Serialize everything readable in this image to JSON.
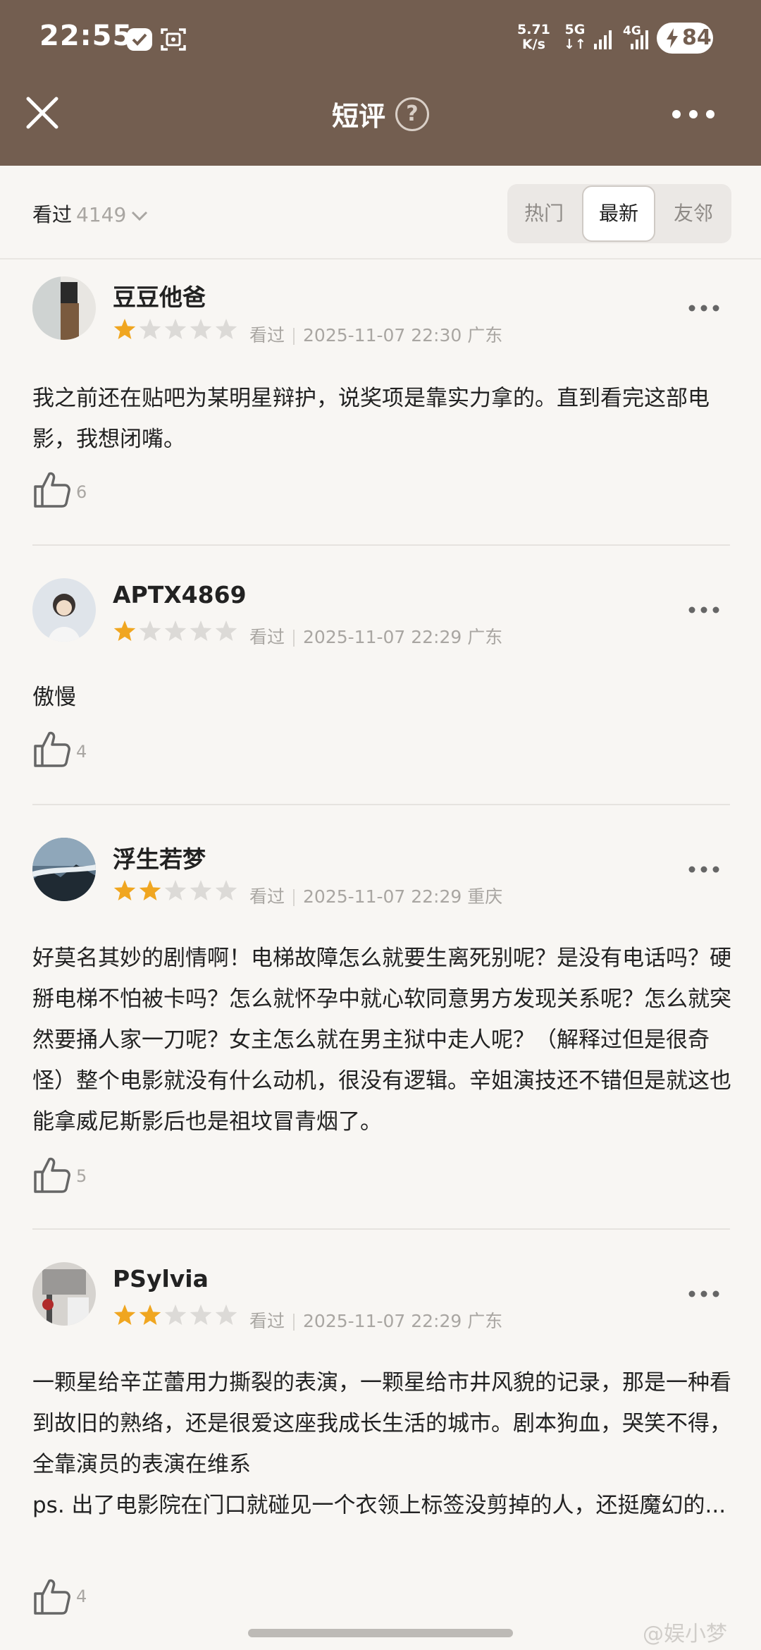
{
  "status": {
    "time": "22:55",
    "net_speed": "5.71",
    "net_unit": "K/s",
    "g5": "5G",
    "g4": "4G",
    "battery": "84"
  },
  "header": {
    "title": "短评",
    "help": "?"
  },
  "filter": {
    "watched_label": "看过",
    "watched_count": "4149",
    "tabs": [
      "热门",
      "最新",
      "友邻"
    ],
    "active_tab": "最新"
  },
  "reviews": [
    {
      "name": "豆豆他爸",
      "rating": 1,
      "status": "看过",
      "datetime": "2025-11-07 22:30",
      "location": "广东",
      "text": "我之前还在贴吧为某明星辩护，说奖项是靠实力拿的。直到看完这部电影，我想闭嘴。",
      "likes": "6"
    },
    {
      "name": "APTX4869",
      "rating": 1,
      "status": "看过",
      "datetime": "2025-11-07 22:29",
      "location": "广东",
      "text": "傲慢",
      "likes": "4"
    },
    {
      "name": "浮生若梦",
      "rating": 2,
      "status": "看过",
      "datetime": "2025-11-07 22:29",
      "location": "重庆",
      "text": "好莫名其妙的剧情啊！电梯故障怎么就要生离死别呢？是没有电话吗？硬掰电梯不怕被卡吗？怎么就怀孕中就心软同意男方发现关系呢？怎么就突然要捅人家一刀呢？女主怎么就在男主狱中走人呢？（解释过但是很奇怪）整个电影就没有什么动机，很没有逻辑。辛姐演技还不错但是就这也能拿威尼斯影后也是祖坟冒青烟了。",
      "likes": "5"
    },
    {
      "name": "PSylvia",
      "rating": 2,
      "status": "看过",
      "datetime": "2025-11-07 22:29",
      "location": "广东",
      "text_lines": [
        "一颗星给辛芷蕾用力撕裂的表演，一颗星给市井风貌的记录，那是一种看到故旧的熟络，还是很爱这座我成长生活的城市。剧本狗血，哭笑不得，全靠演员的表演在维系",
        "ps. 出了电影院在门口就碰见一个衣领上标签没剪掉的人，还挺魔幻的..."
      ],
      "likes": "4"
    }
  ],
  "watermark": "@娱小梦",
  "colors": {
    "header_bg": "#735e50",
    "star_on": "#f0a620",
    "star_off": "#dcdad7",
    "page_bg": "#f8f6f3"
  }
}
